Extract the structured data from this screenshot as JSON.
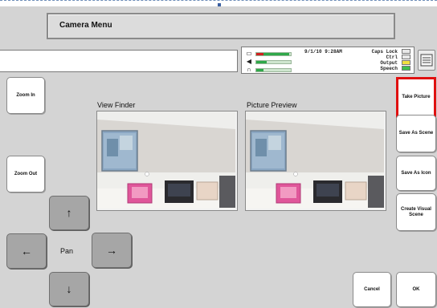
{
  "title": "Camera Menu",
  "status": {
    "datetime": "9/1/10  9:28AM",
    "keyboard_indicators": [
      {
        "label": "Caps Lock",
        "state": "off"
      },
      {
        "label": "Ctrl",
        "state": "off"
      },
      {
        "label": "Output",
        "state": "on-yellow"
      },
      {
        "label": "Speech",
        "state": "on-green"
      }
    ],
    "meters": [
      {
        "icon": "battery-icon",
        "level": 0.9
      },
      {
        "icon": "speaker-icon",
        "level": 0.3
      },
      {
        "icon": "headset-icon",
        "level": 0.2
      }
    ],
    "keyboard_button_icon": "keyboard-icon"
  },
  "left_buttons": {
    "zoom_in": "Zoom In",
    "zoom_out": "Zoom Out"
  },
  "pan": {
    "label": "Pan",
    "up": "↑",
    "down": "↓",
    "left": "←",
    "right": "→"
  },
  "pictures": {
    "view_finder_label": "View Finder",
    "preview_label": "Picture Preview"
  },
  "right_buttons": {
    "take_picture": "Take Picture",
    "save_as_scene": "Save As Scene",
    "save_as_icon": "Save As Icon",
    "create_visual_scene": "Create Visual Scene"
  },
  "bottom_buttons": {
    "cancel": "Cancel",
    "ok": "OK"
  },
  "colors": {
    "highlight": "#e01010",
    "background": "#d4d4d4"
  }
}
